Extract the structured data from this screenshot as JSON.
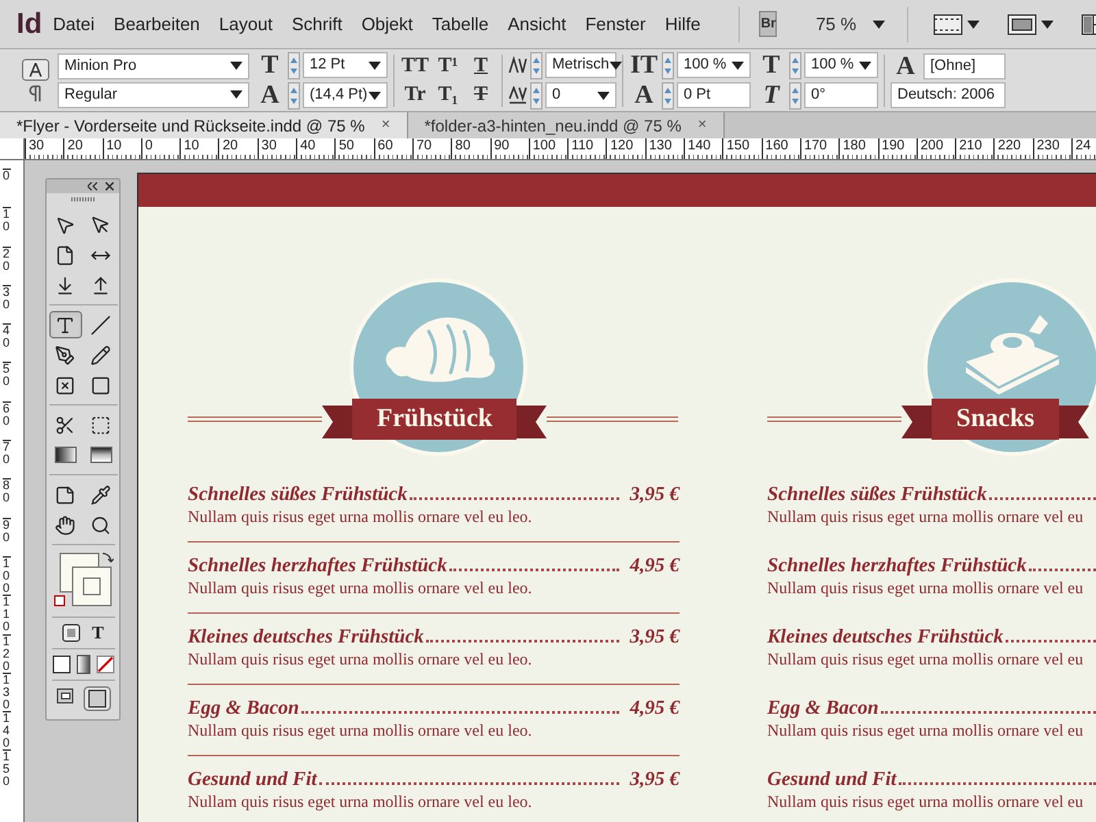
{
  "app_logo": "Id",
  "menu": [
    "Datei",
    "Bearbeiten",
    "Layout",
    "Schrift",
    "Objekt",
    "Tabelle",
    "Ansicht",
    "Fenster",
    "Hilfe"
  ],
  "bridge_button": "Br",
  "zoom": "75 %",
  "control_panel": {
    "glyphs": {
      "font_size": "T",
      "leading": "A",
      "vertical_scale": "IT",
      "baseline_shift": "A",
      "horizontal_scale": "T",
      "skew": "T",
      "character_style": "A"
    },
    "style_buttons": [
      "TT",
      "T¹",
      "T",
      "Tr",
      "T₁",
      "T"
    ],
    "font_family": "Minion Pro",
    "font_style": "Regular",
    "font_size": "12 Pt",
    "leading": "(14,4 Pt)",
    "kerning": "Metrisch",
    "tracking": "0",
    "vertical_scale": "100 %",
    "baseline_shift": "0 Pt",
    "horizontal_scale": "100 %",
    "skew": "0°",
    "character_style": "[Ohne]",
    "language": "Deutsch: 2006"
  },
  "tabs": [
    {
      "label": "*Flyer - Vorderseite und Rückseite.indd @ 75 %",
      "close": "×",
      "selected": true
    },
    {
      "label": "*folder-a3-hinten_neu.indd @ 75 %",
      "close": "×",
      "selected": false
    }
  ],
  "ruler_h": [
    "30",
    "20",
    "10",
    "0",
    "10",
    "20",
    "30",
    "40",
    "50",
    "60",
    "70",
    "80",
    "90",
    "100",
    "110",
    "120",
    "130",
    "140",
    "150",
    "160",
    "170",
    "180",
    "190",
    "200",
    "210",
    "220",
    "230",
    "24"
  ],
  "ruler_v": [
    "0",
    "10",
    "20",
    "30",
    "40",
    "50",
    "60",
    "70",
    "80",
    "90",
    "100",
    "110",
    "120",
    "130",
    "140",
    "150"
  ],
  "text_format_toggle": "T",
  "tool_groups": [
    [
      {
        "kind": "selection",
        "selected": false
      },
      {
        "kind": "direct-selection",
        "selected": false
      },
      {
        "kind": "page",
        "selected": false
      },
      {
        "kind": "gap",
        "selected": false
      },
      {
        "kind": "collector",
        "selected": false
      },
      {
        "kind": "placer",
        "selected": false
      }
    ],
    [
      {
        "kind": "type",
        "selected": true
      },
      {
        "kind": "line",
        "selected": false
      },
      {
        "kind": "pen",
        "selected": false
      },
      {
        "kind": "pencil",
        "selected": false
      },
      {
        "kind": "frame",
        "selected": false
      },
      {
        "kind": "rectangle",
        "selected": false
      }
    ],
    [
      {
        "kind": "scissors",
        "selected": false
      },
      {
        "kind": "transform",
        "selected": false
      },
      {
        "kind": "gradient",
        "selected": false
      },
      {
        "kind": "feather",
        "selected": false
      }
    ],
    [
      {
        "kind": "note",
        "selected": false
      },
      {
        "kind": "eyedropper",
        "selected": false
      },
      {
        "kind": "hand",
        "selected": false
      },
      {
        "kind": "zoom",
        "selected": false
      }
    ]
  ],
  "sections": [
    {
      "title": "Frühstück",
      "kind": "croissant",
      "divided": true,
      "items": [
        {
          "name": "Schnelles süßes Frühstück",
          "price": "3,95 €",
          "description": "Nullam quis risus eget urna mollis ornare vel eu leo."
        },
        {
          "name": "Schnelles herzhaftes Frühstück",
          "price": "4,95 €",
          "description": "Nullam quis risus eget urna mollis ornare vel eu leo."
        },
        {
          "name": "Kleines deutsches Frühstück",
          "price": "3,95 €",
          "description": "Nullam quis risus eget urna mollis ornare vel eu leo."
        },
        {
          "name": "Egg & Bacon",
          "price": "4,95 €",
          "description": "Nullam quis risus eget urna mollis ornare vel eu leo."
        },
        {
          "name": "Gesund und Fit",
          "price": "3,95 €",
          "description": "Nullam quis risus eget urna mollis ornare vel eu leo."
        }
      ]
    },
    {
      "title": "Snacks",
      "kind": "sandwich",
      "divided": false,
      "items": [
        {
          "name": "Schnelles süßes Frühstück",
          "description": "Nullam quis risus eget urna mollis ornare vel eu"
        },
        {
          "name": "Schnelles herzhaftes Frühstück",
          "description": "Nullam quis risus eget urna mollis ornare vel eu"
        },
        {
          "name": "Kleines deutsches Frühstück",
          "description": "Nullam quis risus eget urna mollis ornare vel eu"
        },
        {
          "name": "Egg & Bacon",
          "description": "Nullam quis risus eget urna mollis ornare vel eu"
        },
        {
          "name": "Gesund und Fit",
          "description": "Nullam quis risus eget urna mollis ornare vel eu"
        }
      ]
    }
  ]
}
